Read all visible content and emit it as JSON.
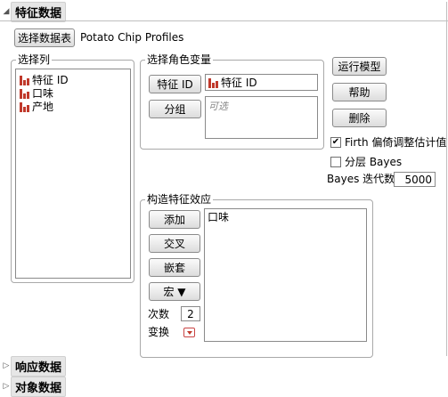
{
  "sections": {
    "main_title": "特征数据",
    "response_title": "响应数据",
    "object_title": "对象数据"
  },
  "data_table": {
    "button_label": "选择数据表",
    "name": "Potato Chip Profiles"
  },
  "select_columns": {
    "label": "选择列",
    "items": [
      "特征 ID",
      "口味",
      "产地"
    ]
  },
  "cast_roles": {
    "label": "选择角色变量",
    "feature_id_button": "特征 ID",
    "feature_id_value": "特征 ID",
    "group_button": "分组",
    "group_placeholder": "可选"
  },
  "actions": {
    "run": "运行模型",
    "help": "帮助",
    "remove": "删除"
  },
  "options": {
    "firth_label": "Firth 偏倚调整估计值",
    "firth_checked": true,
    "hier_bayes_label": "分层 Bayes",
    "hier_bayes_checked": false,
    "bayes_iter_label": "Bayes 迭代数",
    "bayes_iter_value": "5000"
  },
  "construct_effects": {
    "label": "构造特征效应",
    "add": "添加",
    "cross": "交叉",
    "nest": "嵌套",
    "macro": "宏 ▼",
    "effects": [
      "口味"
    ],
    "degree_label": "次数",
    "degree_value": "2",
    "transform_label": "变换"
  },
  "colors": {
    "accent_red": "#c0392b",
    "header_bg": "#e6e6e6",
    "border": "#a9a9a9"
  }
}
